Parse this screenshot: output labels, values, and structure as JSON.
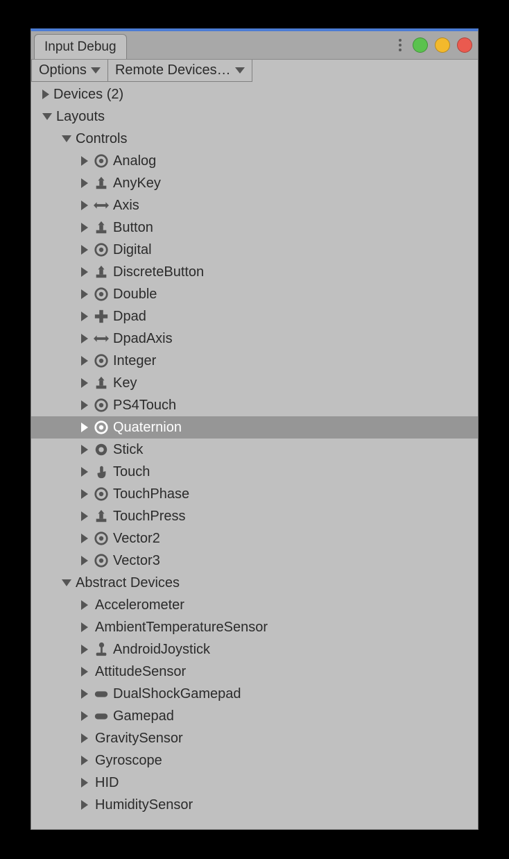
{
  "window": {
    "tab_title": "Input Debug"
  },
  "toolbar": {
    "options_label": "Options",
    "remote_label": "Remote Devices…"
  },
  "tree": {
    "devices_label": "Devices (2)",
    "layouts_label": "Layouts",
    "controls_label": "Controls",
    "controls": [
      {
        "label": "Analog",
        "icon": "ring"
      },
      {
        "label": "AnyKey",
        "icon": "key"
      },
      {
        "label": "Axis",
        "icon": "axis"
      },
      {
        "label": "Button",
        "icon": "key"
      },
      {
        "label": "Digital",
        "icon": "ring"
      },
      {
        "label": "DiscreteButton",
        "icon": "key"
      },
      {
        "label": "Double",
        "icon": "ring"
      },
      {
        "label": "Dpad",
        "icon": "dpad"
      },
      {
        "label": "DpadAxis",
        "icon": "axis"
      },
      {
        "label": "Integer",
        "icon": "ring"
      },
      {
        "label": "Key",
        "icon": "key"
      },
      {
        "label": "PS4Touch",
        "icon": "ring"
      },
      {
        "label": "Quaternion",
        "icon": "ring",
        "selected": true
      },
      {
        "label": "Stick",
        "icon": "ball"
      },
      {
        "label": "Touch",
        "icon": "finger"
      },
      {
        "label": "TouchPhase",
        "icon": "ring"
      },
      {
        "label": "TouchPress",
        "icon": "key"
      },
      {
        "label": "Vector2",
        "icon": "ring"
      },
      {
        "label": "Vector3",
        "icon": "ring"
      }
    ],
    "abstract_label": "Abstract Devices",
    "abstract": [
      {
        "label": "Accelerometer",
        "icon": "none"
      },
      {
        "label": "AmbientTemperatureSensor",
        "icon": "none"
      },
      {
        "label": "AndroidJoystick",
        "icon": "joystick"
      },
      {
        "label": "AttitudeSensor",
        "icon": "none"
      },
      {
        "label": "DualShockGamepad",
        "icon": "gamepad"
      },
      {
        "label": "Gamepad",
        "icon": "gamepad"
      },
      {
        "label": "GravitySensor",
        "icon": "none"
      },
      {
        "label": "Gyroscope",
        "icon": "none"
      },
      {
        "label": "HID",
        "icon": "none"
      },
      {
        "label": "HumiditySensor",
        "icon": "none"
      }
    ]
  }
}
